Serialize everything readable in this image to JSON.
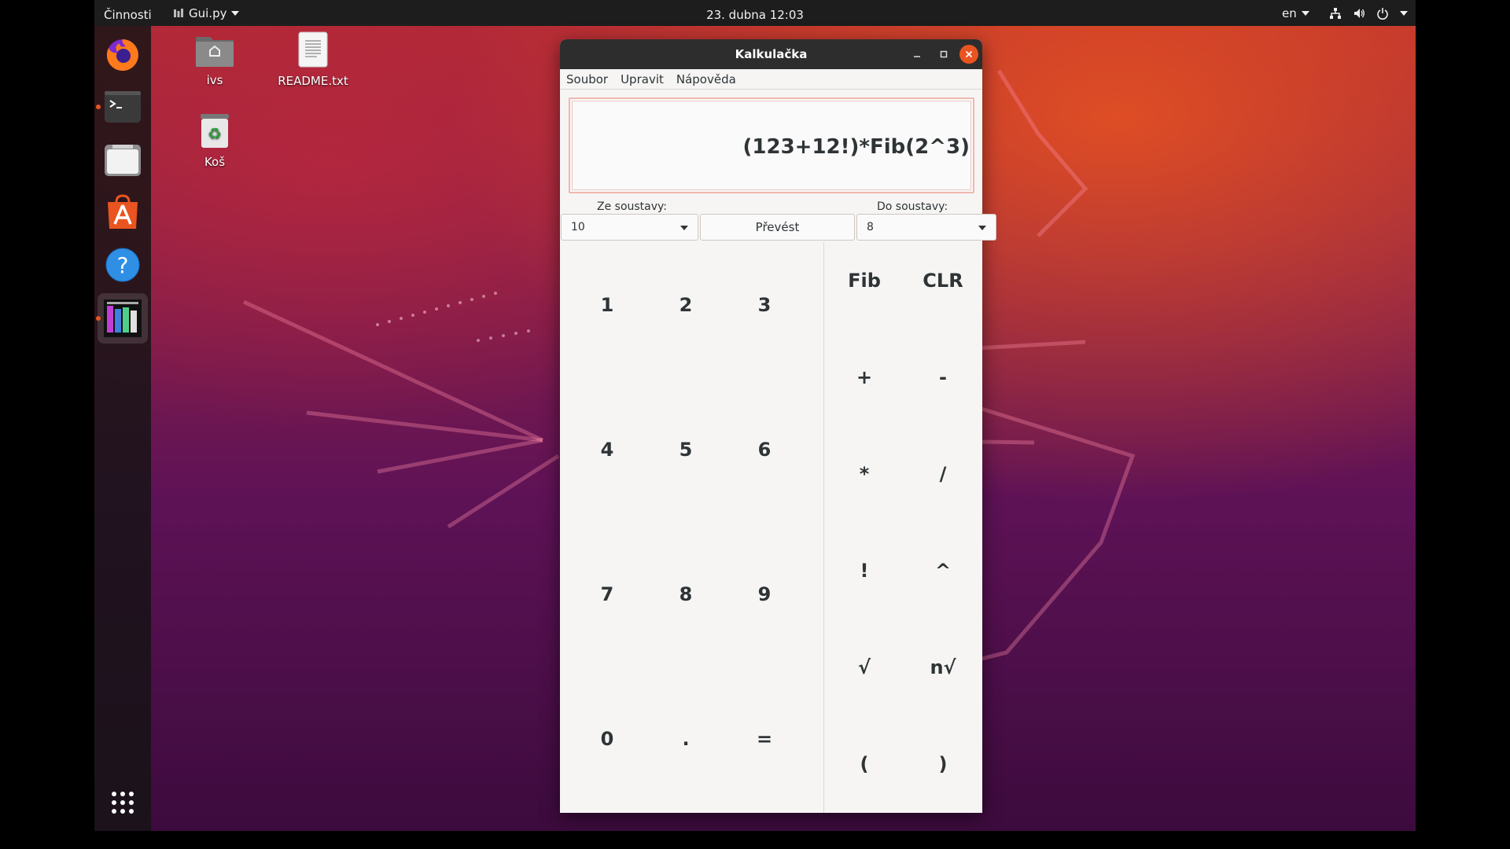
{
  "topbar": {
    "activities": "Činnosti",
    "app_menu": "Gui.py",
    "clock": "23. dubna  12:03",
    "language": "en"
  },
  "dock": {
    "items": [
      "firefox-icon",
      "terminal-icon",
      "files-icon",
      "software-center-icon",
      "help-icon",
      "image-viewer-icon"
    ]
  },
  "desktop": {
    "icons": [
      {
        "label": "ivs"
      },
      {
        "label": "README.txt"
      },
      {
        "label": "Koš"
      }
    ]
  },
  "calculator": {
    "title": "Kalkulačka",
    "menu": [
      "Soubor",
      "Upravit",
      "Nápověda"
    ],
    "expression": "(123+12!)*Fib(2^3)",
    "from_label": "Ze soustavy:",
    "from_value": "10",
    "convert_label": "Převést",
    "to_label": "Do soustavy:",
    "to_value": "8",
    "number_keys": [
      "1",
      "2",
      "3",
      "4",
      "5",
      "6",
      "7",
      "8",
      "9",
      "0",
      ".",
      "="
    ],
    "operator_keys": [
      "Fib",
      "CLR",
      "+",
      "-",
      "*",
      "/",
      "!",
      "^",
      "√",
      "n√",
      "(",
      ")"
    ]
  },
  "colors": {
    "accent": "#e95420",
    "panel": "#1d1d1d",
    "window_bg": "#f6f5f4"
  }
}
